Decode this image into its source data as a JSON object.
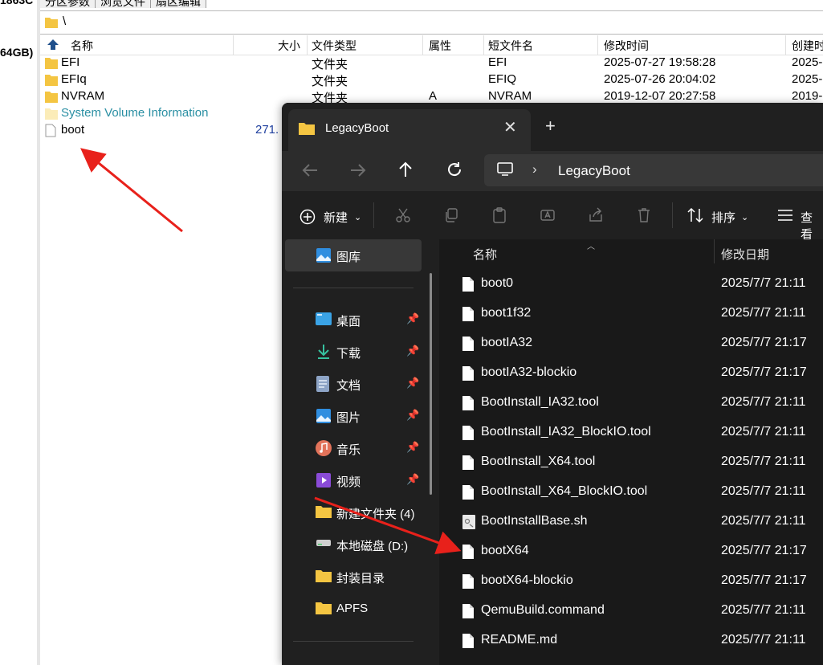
{
  "background_app": {
    "left_text_top": "1863C",
    "left_text_size": "64GB)",
    "tabs": [
      "分区参数",
      "浏览文件",
      "扇区编辑"
    ],
    "path": "\\",
    "columns": [
      "名称",
      "大小",
      "文件类型",
      "属性",
      "短文件名",
      "修改时间",
      "创建时"
    ],
    "files": [
      {
        "name": "EFI",
        "size": "",
        "type": "文件夹",
        "attr": "",
        "short": "EFI",
        "modified": "2025-07-27 19:58:28",
        "created": "2025-"
      },
      {
        "name": "EFIq",
        "size": "",
        "type": "文件夹",
        "attr": "",
        "short": "EFIQ",
        "modified": "2025-07-26 20:04:02",
        "created": "2025-"
      },
      {
        "name": "NVRAM",
        "size": "",
        "type": "文件夹",
        "attr": "A",
        "short": "NVRAM",
        "modified": "2019-12-07 20:27:58",
        "created": "2019-"
      },
      {
        "name": "System Volume Information",
        "size": "",
        "type": "",
        "attr": "",
        "short": "",
        "modified": "",
        "created": ""
      },
      {
        "name": "boot",
        "size": "271.",
        "type": "",
        "attr": "",
        "short": "",
        "modified": "",
        "created": ""
      }
    ]
  },
  "explorer": {
    "tab_title": "LegacyBoot",
    "new_tab": "+",
    "close": "✕",
    "address": "LegacyBoot",
    "toolbar": {
      "new": "新建",
      "sort": "排序",
      "view": "查看"
    },
    "sidebar": {
      "gallery": "图库",
      "items": [
        {
          "label": "桌面",
          "icon": "desktop-icon",
          "pinned": true
        },
        {
          "label": "下载",
          "icon": "download-icon",
          "pinned": true
        },
        {
          "label": "文档",
          "icon": "documents-icon",
          "pinned": true
        },
        {
          "label": "图片",
          "icon": "pictures-icon",
          "pinned": true
        },
        {
          "label": "音乐",
          "icon": "music-icon",
          "pinned": true
        },
        {
          "label": "视频",
          "icon": "videos-icon",
          "pinned": true
        },
        {
          "label": "新建文件夹 (4)",
          "icon": "folder-icon",
          "pinned": false
        },
        {
          "label": "本地磁盘 (D:)",
          "icon": "drive-icon",
          "pinned": false
        },
        {
          "label": "封装目录",
          "icon": "folder-icon",
          "pinned": false
        },
        {
          "label": "APFS",
          "icon": "folder-icon",
          "pinned": false
        }
      ]
    },
    "list_header": {
      "name": "名称",
      "date": "修改日期"
    },
    "files": [
      {
        "name": "boot0",
        "date": "2025/7/7 21:11"
      },
      {
        "name": "boot1f32",
        "date": "2025/7/7 21:11"
      },
      {
        "name": "bootIA32",
        "date": "2025/7/7 21:17"
      },
      {
        "name": "bootIA32-blockio",
        "date": "2025/7/7 21:17"
      },
      {
        "name": "BootInstall_IA32.tool",
        "date": "2025/7/7 21:11"
      },
      {
        "name": "BootInstall_IA32_BlockIO.tool",
        "date": "2025/7/7 21:11"
      },
      {
        "name": "BootInstall_X64.tool",
        "date": "2025/7/7 21:11"
      },
      {
        "name": "BootInstall_X64_BlockIO.tool",
        "date": "2025/7/7 21:11"
      },
      {
        "name": "BootInstallBase.sh",
        "date": "2025/7/7 21:11"
      },
      {
        "name": "bootX64",
        "date": "2025/7/7 21:17"
      },
      {
        "name": "bootX64-blockio",
        "date": "2025/7/7 21:17"
      },
      {
        "name": "QemuBuild.command",
        "date": "2025/7/7 21:11"
      },
      {
        "name": "README.md",
        "date": "2025/7/7 21:11"
      }
    ]
  },
  "colors": {
    "arrow": "#e8211b",
    "folder": "#f4c542",
    "dark_bg": "#191919",
    "sysvol_text": "#2a8fa3"
  }
}
